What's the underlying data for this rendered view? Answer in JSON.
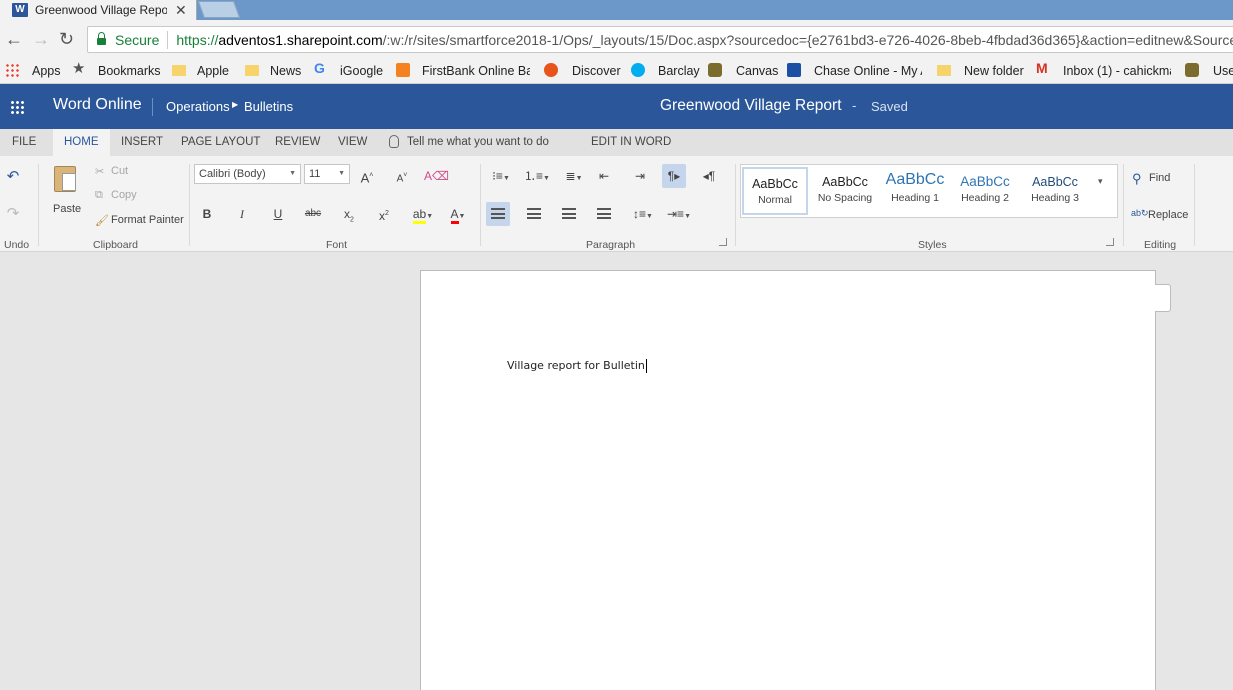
{
  "browser": {
    "tab_title": "Greenwood Village Repo",
    "tab_close": "✕",
    "secure_label": "Secure",
    "url_proto": "https://",
    "url_host": "adventos1.sharepoint.com",
    "url_path": "/:w:/r/sites/smartforce2018-1/Ops/_layouts/15/Doc.aspx?sourcedoc={e2761bd3-e726-4026-8beb-4fbdad36d365}&action=editnew&Source"
  },
  "bookmarks": {
    "items": [
      "Apps",
      "Bookmarks",
      "Apple",
      "News",
      "iGoogle",
      "FirstBank Online Ban",
      "Discover",
      "Barclay",
      "Canvas",
      "Chase Online - My A",
      "New folder",
      "Inbox (1) - cahickma",
      "Use"
    ]
  },
  "app": {
    "name": "Word Online",
    "breadcrumb_parent": "Operations",
    "breadcrumb_child": "Bulletins",
    "document_title": "Greenwood Village Report",
    "separator": "-",
    "save_status": "Saved"
  },
  "ribbon": {
    "tabs": [
      "FILE",
      "HOME",
      "INSERT",
      "PAGE LAYOUT",
      "REVIEW",
      "VIEW"
    ],
    "active_tab": "HOME",
    "tell_me": "Tell me what you want to do",
    "edit_in_word": "EDIT IN WORD",
    "undo_group": "Undo",
    "clipboard": {
      "paste": "Paste",
      "cut": "Cut",
      "copy": "Copy",
      "format_painter": "Format Painter",
      "label": "Clipboard"
    },
    "font": {
      "family": "Calibri (Body)",
      "size": "11",
      "label": "Font"
    },
    "paragraph": {
      "label": "Paragraph"
    },
    "styles": {
      "label": "Styles",
      "items": [
        {
          "sample": "AaBbCc",
          "name": "Normal"
        },
        {
          "sample": "AaBbCc",
          "name": "No Spacing"
        },
        {
          "sample": "AaBbCc",
          "name": "Heading 1"
        },
        {
          "sample": "AaBbCc",
          "name": "Heading 2"
        },
        {
          "sample": "AaBbCc",
          "name": "Heading 3"
        }
      ],
      "selected": "Normal"
    },
    "editing": {
      "find": "Find",
      "replace": "Replace",
      "label": "Editing"
    }
  },
  "document": {
    "body_text": "Village report for Bulletin"
  },
  "colors": {
    "brand": "#2b579a",
    "highlight": "#ffff00",
    "font_color": "#ff0000"
  }
}
